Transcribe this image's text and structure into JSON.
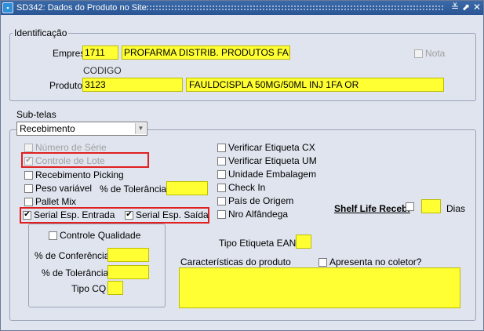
{
  "window": {
    "title": "SD342: Dados do Produto no Site",
    "icon": "app-icon"
  },
  "identificacao": {
    "legend": "Identificação",
    "empresa_label": "Empresa",
    "empresa_code": "1711",
    "empresa_name": "PROFARMA DISTRIB. PRODUTOS FARM",
    "nota_label": "Nota",
    "codigo_label": "CODIGO",
    "produto_label": "Produto",
    "produto_code": "3123",
    "produto_name": "FAULDCISPLA 50MG/50ML INJ 1FA OR"
  },
  "subtelas": {
    "label": "Sub-telas",
    "selected": "Recebimento"
  },
  "recebimento": {
    "numero_serie": "Número de Série",
    "controle_lote": "Controle de Lote",
    "recebimento_picking": "Recebimento Picking",
    "peso_variavel": "Peso variável",
    "tolerancia_label": "% de Tolerância",
    "pallet_mix": "Pallet Mix",
    "serial_entrada": "Serial Esp. Entrada",
    "serial_saida": "Serial Esp. Saída",
    "controle_qualidade": "Controle Qualidade",
    "conferencia_label": "% de Conferência",
    "tolerancia2_label": "% de Tolerância",
    "tipo_cq_label": "Tipo CQ",
    "verificar_cx": "Verificar Etiqueta CX",
    "verificar_um": "Verificar Etiqueta UM",
    "unidade_embalagem": "Unidade Embalagem",
    "check_in": "Check In",
    "pais_origem": "País de Origem",
    "nro_alfandega": "Nro Alfândega",
    "shelf_life": "Shelf Life Receb.",
    "dias": "Dias",
    "tipo_etiqueta": "Tipo Etiqueta EAN",
    "caracteristicas": "Características do produto",
    "apresenta": "Apresenta no coletor?"
  },
  "checked": {
    "controle_lote": true,
    "serial_entrada": true,
    "serial_saida": true
  }
}
